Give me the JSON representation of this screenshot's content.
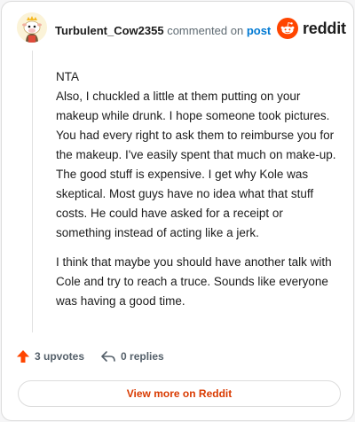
{
  "header": {
    "username": "Turbulent_Cow2355",
    "commented_on": "commented on",
    "post_link": "post",
    "brand": "reddit"
  },
  "comment": {
    "paragraphs": [
      "NTA",
      "Also, I chuckled a little at them putting on your makeup while drunk. I hope someone took pictures. You had every right to ask them to reimburse you for the makeup. I've easily spent that much on make-up. The good stuff is expensive. I get why Kole was skeptical. Most guys have no idea what that stuff costs. He could have asked for a receipt or something instead of acting like a jerk.",
      "I think that maybe you should have another talk with Cole and try to reach a truce. Sounds like everyone was having a good time."
    ]
  },
  "actions": {
    "upvotes": "3 upvotes",
    "replies": "0 replies"
  },
  "footer": {
    "view_more": "View more on Reddit"
  },
  "colors": {
    "brand_orange": "#ff4500",
    "link_blue": "#0079d3",
    "view_more_text": "#d93a00"
  },
  "icons": {
    "avatar": "snoo-avatar-icon",
    "logo": "reddit-logo-icon",
    "upvote": "upvote-arrow-icon",
    "reply": "reply-arrow-icon"
  }
}
